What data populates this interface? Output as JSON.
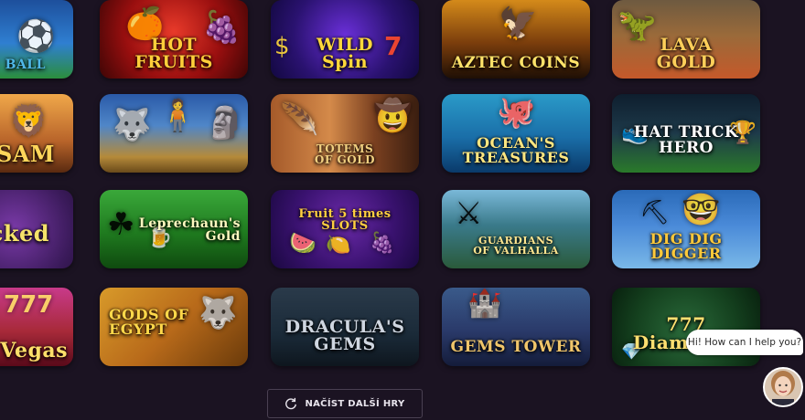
{
  "games": [
    {
      "title": "BALL",
      "color": "#4fb8e8"
    },
    {
      "title": "HOT\nFRUITS",
      "color": "#ffce3a"
    },
    {
      "title": "WILD\nSpin",
      "color": "#ffd83a"
    },
    {
      "title": "AZTEC COINS",
      "color": "#ffe36a"
    },
    {
      "title": "LAVA\nGOLD",
      "color": "#ffcf5a"
    },
    {
      "title": "SAM",
      "color": "#ffd65a"
    },
    {
      "title": "",
      "color": "#ffd65a"
    },
    {
      "title": "TOTEMS\nOF GOLD",
      "color": "#f2d080"
    },
    {
      "title": "OCEAN'S\nTREASURES",
      "color": "#ffe680"
    },
    {
      "title": "HAT TRICK\nHERO",
      "color": "#ffffff"
    },
    {
      "title": "cked",
      "color": "#f5e36a"
    },
    {
      "title": "Leprechaun's\nGold",
      "color": "#fff9c0"
    },
    {
      "title": "Fruit 5 times\nSLOTS",
      "color": "#ffcf40"
    },
    {
      "title": "GUARDIANS\nOF VALHALLA",
      "color": "#ffe690"
    },
    {
      "title": "DIG DIG DIGGER",
      "color": "#ffc93a"
    },
    {
      "title": "Vegas",
      "color": "#ffdf6a"
    },
    {
      "title": "GODS OF\nEGYPT",
      "color": "#ffd84a"
    },
    {
      "title": "DRACULA'S\nGEMS",
      "color": "#cfd6e0"
    },
    {
      "title": "GEMS TOWER",
      "color": "#f0c56a"
    },
    {
      "title": "777\nDiamonds",
      "color": "#ffe070"
    }
  ],
  "load_more": {
    "label": "NAČÍST DALŠÍ HRY"
  },
  "chat": {
    "bubble": "Hi! How can I help you?"
  }
}
